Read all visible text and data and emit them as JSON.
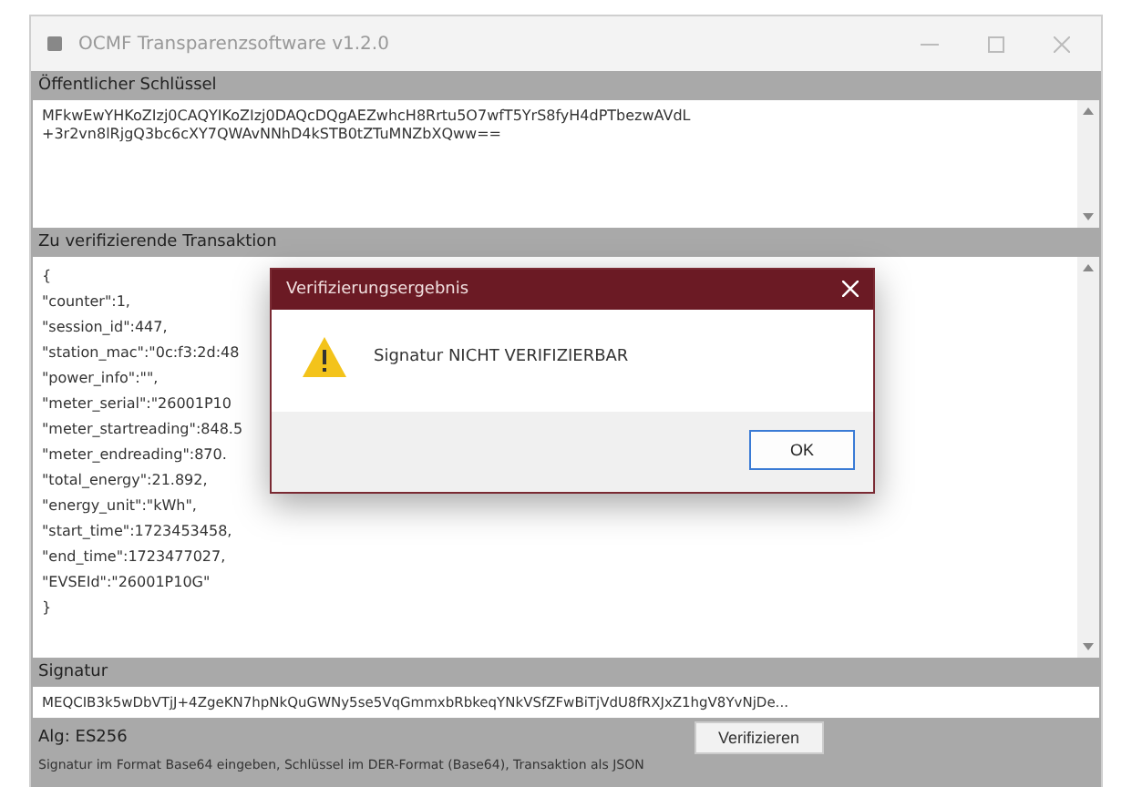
{
  "window": {
    "title": "OCMF Transparenzsoftware v1.2.0"
  },
  "public_key": {
    "label": "Öffentlicher Schlüssel",
    "value": "MFkwEwYHKoZIzj0CAQYIKoZIzj0DAQcDQgAEZwhcH8Rrtu5O7wfT5YrS8fyH4dPTbezwAVdL\n+3r2vn8lRjgQ3bc6cXY7QWAvNNhD4kSTB0tZTuMNZbXQww=="
  },
  "transaction": {
    "label": "Zu verifizierende Transaktion",
    "lines": [
      "{",
      "\"counter\":1,",
      "\"session_id\":447,",
      "\"station_mac\":\"0c:f3:2d:48",
      "\"power_info\":\"\",",
      "\"meter_serial\":\"26001P10",
      "\"meter_startreading\":848.5",
      "\"meter_endreading\":870.",
      "\"total_energy\":21.892,",
      "\"energy_unit\":\"kWh\",",
      "\"start_time\":1723453458,",
      "\"end_time\":1723477027,",
      "\"EVSEId\":\"26001P10G\"",
      "}"
    ]
  },
  "signature": {
    "label": "Signatur",
    "value": "MEQCIB3k5wDbVTjJ+4ZgeKN7hpNkQuGWNy5se5VqGmmxbRbkeqYNkVSfZFwBiTjVdU8fRXJxZ1hgV8YvNjDe..."
  },
  "algorithm": {
    "label": "Alg: ES256"
  },
  "verify_button": "Verifizieren",
  "hint": "Signatur im Format Base64 eingeben, Schlüssel im DER-Format (Base64), Transaktion als JSON",
  "dialog": {
    "title": "Verifizierungsergebnis",
    "message": "Signatur NICHT VERIFIZIERBAR",
    "button": "OK"
  }
}
